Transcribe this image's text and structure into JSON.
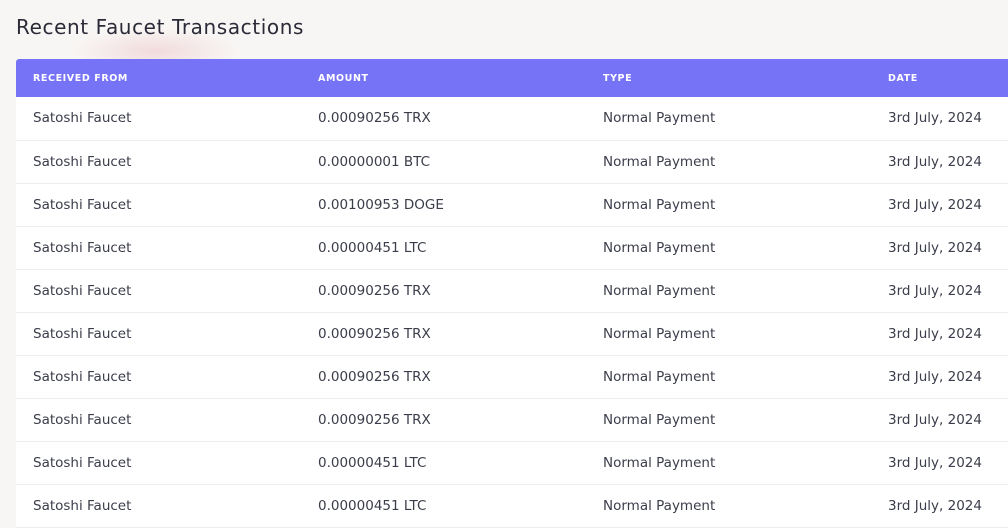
{
  "page": {
    "title": "Recent Faucet Transactions"
  },
  "colors": {
    "header_bg": "#7773f7",
    "header_text": "#ffffff",
    "page_bg": "#f8f6f4",
    "row_text": "#3a3d4a"
  },
  "table": {
    "columns": [
      "RECEIVED FROM",
      "AMOUNT",
      "TYPE",
      "DATE"
    ],
    "rows": [
      {
        "from": "Satoshi Faucet",
        "amount": "0.00090256 TRX",
        "type": "Normal Payment",
        "date": "3rd July, 2024"
      },
      {
        "from": "Satoshi Faucet",
        "amount": "0.00000001 BTC",
        "type": "Normal Payment",
        "date": "3rd July, 2024"
      },
      {
        "from": "Satoshi Faucet",
        "amount": "0.00100953 DOGE",
        "type": "Normal Payment",
        "date": "3rd July, 2024"
      },
      {
        "from": "Satoshi Faucet",
        "amount": "0.00000451 LTC",
        "type": "Normal Payment",
        "date": "3rd July, 2024"
      },
      {
        "from": "Satoshi Faucet",
        "amount": "0.00090256 TRX",
        "type": "Normal Payment",
        "date": "3rd July, 2024"
      },
      {
        "from": "Satoshi Faucet",
        "amount": "0.00090256 TRX",
        "type": "Normal Payment",
        "date": "3rd July, 2024"
      },
      {
        "from": "Satoshi Faucet",
        "amount": "0.00090256 TRX",
        "type": "Normal Payment",
        "date": "3rd July, 2024"
      },
      {
        "from": "Satoshi Faucet",
        "amount": "0.00090256 TRX",
        "type": "Normal Payment",
        "date": "3rd July, 2024"
      },
      {
        "from": "Satoshi Faucet",
        "amount": "0.00000451 LTC",
        "type": "Normal Payment",
        "date": "3rd July, 2024"
      },
      {
        "from": "Satoshi Faucet",
        "amount": "0.00000451 LTC",
        "type": "Normal Payment",
        "date": "3rd July, 2024"
      }
    ]
  }
}
